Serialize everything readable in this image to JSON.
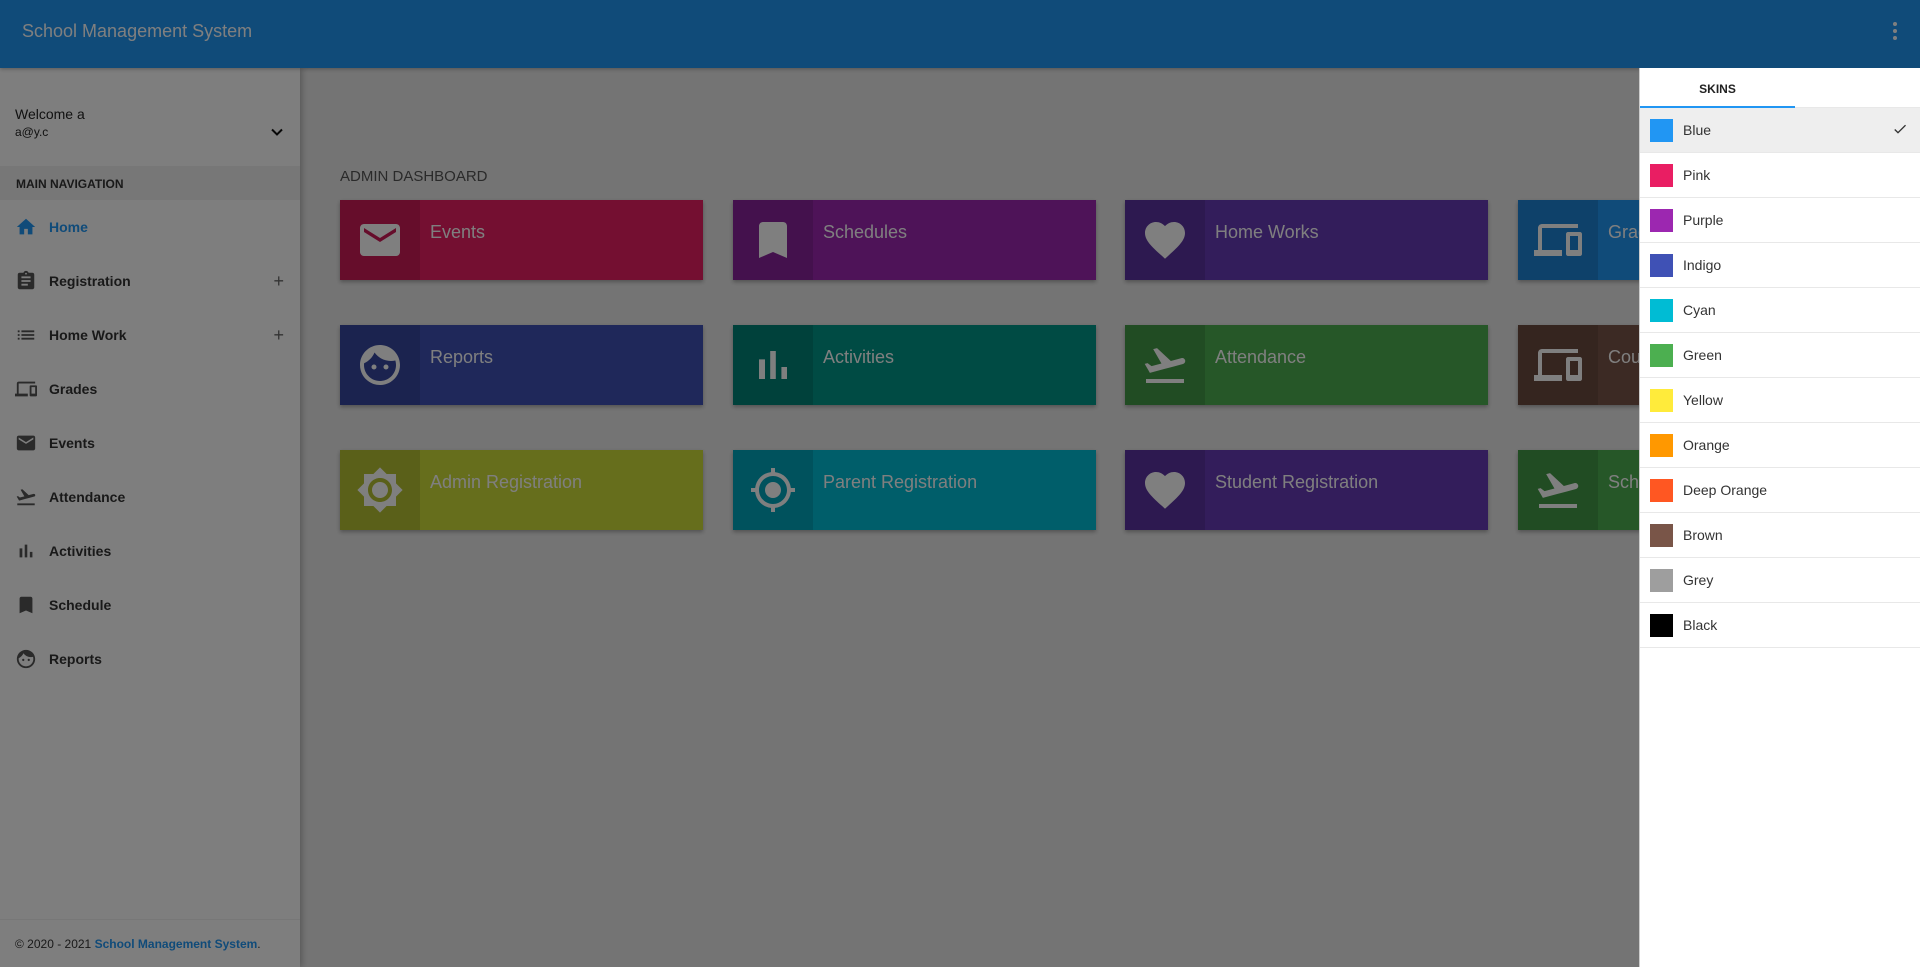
{
  "app": {
    "title": "School Management System"
  },
  "user": {
    "welcome": "Welcome a",
    "email": "a@y.c"
  },
  "sidebar": {
    "header": "MAIN NAVIGATION",
    "items": [
      {
        "label": "Home",
        "icon": "home-icon",
        "active": true
      },
      {
        "label": "Registration",
        "icon": "clipboard-icon",
        "expand": "+"
      },
      {
        "label": "Home Work",
        "icon": "list-icon",
        "expand": "+"
      },
      {
        "label": "Grades",
        "icon": "devices-icon"
      },
      {
        "label": "Events",
        "icon": "mail-icon"
      },
      {
        "label": "Attendance",
        "icon": "flight-takeoff-icon"
      },
      {
        "label": "Activities",
        "icon": "bar-chart-icon"
      },
      {
        "label": "Schedule",
        "icon": "bookmark-icon"
      },
      {
        "label": "Reports",
        "icon": "face-icon"
      }
    ]
  },
  "footer": {
    "copyright": "© 2020 - 2021 ",
    "link": "School Management System",
    "period": "."
  },
  "dashboard": {
    "title": "ADMIN DASHBOARD",
    "tiles": [
      {
        "label": "Events",
        "color": "#e91e63",
        "icon": "mail-icon"
      },
      {
        "label": "Schedules",
        "color": "#9c27b0",
        "icon": "bookmark-icon"
      },
      {
        "label": "Home Works",
        "color": "#673ab7",
        "icon": "heart-icon"
      },
      {
        "label": "Grades",
        "color": "#2196f3",
        "icon": "devices-icon"
      },
      {
        "label": "Reports",
        "color": "#3f51b5",
        "icon": "face-icon"
      },
      {
        "label": "Activities",
        "color": "#009688",
        "icon": "bar-chart-icon"
      },
      {
        "label": "Attendance",
        "color": "#4caf50",
        "icon": "flight-takeoff-icon"
      },
      {
        "label": "Courses",
        "color": "#795548",
        "icon": "devices-icon"
      },
      {
        "label": "Admin Registration",
        "color": "#cddc39",
        "icon": "brightness-icon"
      },
      {
        "label": "Parent Registration",
        "color": "#00bcd4",
        "icon": "gps-icon"
      },
      {
        "label": "Student Registration",
        "color": "#673ab7",
        "icon": "heart-icon"
      },
      {
        "label": "Schedule",
        "color": "#4caf50",
        "icon": "flight-takeoff-icon"
      }
    ]
  },
  "rightpanel": {
    "tab": "SKINS",
    "skins": [
      {
        "name": "Blue",
        "color": "#2196f3",
        "selected": true
      },
      {
        "name": "Pink",
        "color": "#e91e63"
      },
      {
        "name": "Purple",
        "color": "#9c27b0"
      },
      {
        "name": "Indigo",
        "color": "#3f51b5"
      },
      {
        "name": "Cyan",
        "color": "#00bcd4"
      },
      {
        "name": "Green",
        "color": "#4caf50"
      },
      {
        "name": "Yellow",
        "color": "#ffeb3b"
      },
      {
        "name": "Orange",
        "color": "#ff9800"
      },
      {
        "name": "Deep Orange",
        "color": "#ff5722"
      },
      {
        "name": "Brown",
        "color": "#795548"
      },
      {
        "name": "Grey",
        "color": "#9e9e9e"
      },
      {
        "name": "Black",
        "color": "#000000"
      }
    ]
  }
}
